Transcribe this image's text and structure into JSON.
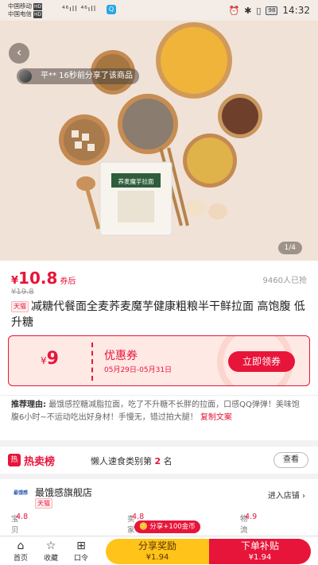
{
  "status_bar": {
    "carrier1": "中国移动",
    "carrier2": "中国电信",
    "hd": "HD",
    "signal": "⁴⁶ıll ⁴⁶ıll",
    "battery": "98",
    "time": "14:32"
  },
  "hero": {
    "share_text": "平** 16秒前分享了该商品",
    "page_indicator": "1/4",
    "package_label": "荞麦魔芋拉面",
    "bg_color": "#f0e2d6"
  },
  "product": {
    "currency": "¥",
    "price": "10.8",
    "price_tag": "券后",
    "original_price": "¥19.8",
    "sold": "9460人已抢",
    "tmall_badge": "天猫",
    "title": "减糖代餐面全麦荞麦魔芋健康粗粮半干鲜拉面 高饱腹 低升糖"
  },
  "coupon": {
    "currency": "¥",
    "amount": "9",
    "title": "优惠券",
    "dates": "05月29日-05月31日",
    "claim_label": "立即领券",
    "accent": "#e8153a"
  },
  "recommend": {
    "label": "推荐理由:",
    "text": "最饿感控糖减脂拉面，吃了不升糖不长胖的拉面，口感QQ弹弹！美味饱腹6小时~不运动吃出好身材！手慢无，错过拍大腿！",
    "copy_label": "复制文案"
  },
  "hot_list": {
    "title": "热卖榜",
    "text_prefix": "懒人速食类别第",
    "rank": "2",
    "text_suffix": "名",
    "view_label": "查看"
  },
  "store": {
    "logo": "最饿感",
    "name": "最饿感旗舰店",
    "tmall_badge": "天猫",
    "enter_label": "进入店铺",
    "scores": [
      {
        "label": "宝贝描述",
        "value": "4.8"
      },
      {
        "label": "卖家服务",
        "value": "4.8"
      },
      {
        "label": "物流服务",
        "value": "4.9"
      }
    ]
  },
  "bottom_bar": {
    "nav": [
      {
        "label": "首页",
        "icon": "home-icon"
      },
      {
        "label": "收藏",
        "icon": "star-icon"
      },
      {
        "label": "口令",
        "icon": "token-icon"
      }
    ],
    "coin_pill": "分享+100金币",
    "share_label": "分享奖励",
    "share_value": "¥1.94",
    "buy_label": "下单补贴",
    "buy_value": "¥1.94"
  }
}
